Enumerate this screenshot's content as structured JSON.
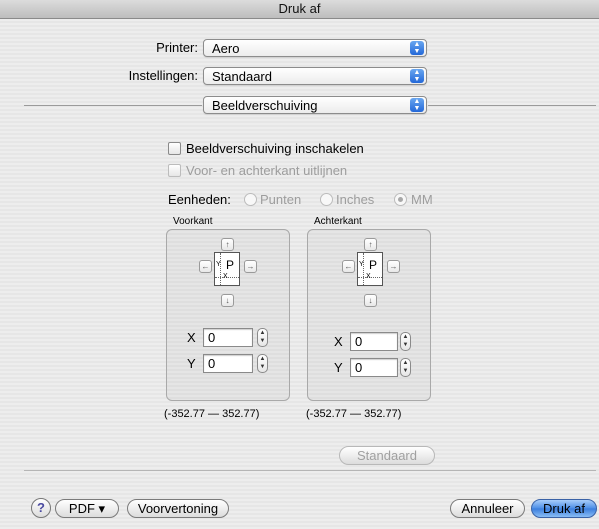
{
  "window": {
    "title": "Druk af"
  },
  "printer": {
    "label": "Printer:",
    "value": "Aero"
  },
  "settings": {
    "label": "Instellingen:",
    "value": "Standaard"
  },
  "panel": {
    "value": "Beeldverschuiving"
  },
  "options": {
    "enable_label": "Beeldverschuiving inschakelen",
    "align_label": "Voor- en achterkant uitlijnen"
  },
  "units": {
    "label": "Eenheden:",
    "options": [
      "Punten",
      "Inches",
      "MM"
    ],
    "selected": "MM"
  },
  "front": {
    "title": "Voorkant",
    "x_label": "X",
    "x_value": "0",
    "y_label": "Y",
    "y_value": "0",
    "range": "(-352.77  —  352.77)"
  },
  "back": {
    "title": "Achterkant",
    "x_label": "X",
    "x_value": "0",
    "y_label": "Y",
    "y_value": "0",
    "range": "(-352.77  —  352.77)"
  },
  "page_preview": {
    "letter": "P",
    "axis_x": "X",
    "axis_y": "Y"
  },
  "arrow_glyphs": {
    "up": "↑",
    "down": "↓",
    "left": "←",
    "right": "→"
  },
  "buttons": {
    "standaard": "Standaard",
    "help": "?",
    "pdf": "PDF ▾",
    "preview": "Voorvertoning",
    "cancel": "Annuleer",
    "print": "Druk af"
  }
}
